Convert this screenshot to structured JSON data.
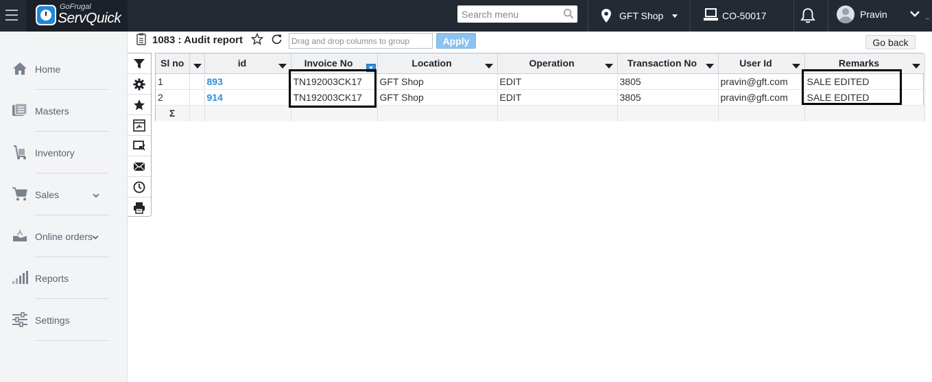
{
  "topbar": {
    "brand_small": "GoFrugal",
    "brand_name": "ServQuick",
    "search_placeholder": "Search menu",
    "location": "GFT Shop",
    "counter": "CO-50017",
    "user": "Pravin",
    "more": "..."
  },
  "sidebar": {
    "items": [
      {
        "label": "Home",
        "icon": "home-icon"
      },
      {
        "label": "Masters",
        "icon": "masters-icon"
      },
      {
        "label": "Inventory",
        "icon": "inventory-icon"
      },
      {
        "label": "Sales",
        "icon": "cart-icon",
        "expandable": true
      },
      {
        "label": "Online orders",
        "icon": "online-orders-icon",
        "expandable": true
      },
      {
        "label": "Reports",
        "icon": "bar-chart-icon"
      },
      {
        "label": "Settings",
        "icon": "sliders-icon"
      }
    ]
  },
  "page": {
    "title": "1083 : Audit report",
    "group_placeholder": "Drag and drop columns to group",
    "apply_label": "Apply",
    "go_back_label": "Go back"
  },
  "tools": [
    "filter-icon",
    "gear-icon",
    "star-icon",
    "column-chooser-icon",
    "export-icon",
    "mail-icon",
    "clock-icon",
    "print-icon"
  ],
  "grid": {
    "columns": [
      "Sl no",
      "id",
      "Invoice No",
      "Location",
      "Operation",
      "Transaction No",
      "User Id",
      "Remarks"
    ],
    "rows": [
      {
        "sl": "1",
        "id": "893",
        "invoice": "TN192003CK17",
        "location": "GFT Shop",
        "operation": "EDIT",
        "txn": "3805",
        "user": "pravin@gft.com",
        "remarks": "SALE EDITED"
      },
      {
        "sl": "2",
        "id": "914",
        "invoice": "TN192003CK17",
        "location": "GFT Shop",
        "operation": "EDIT",
        "txn": "3805",
        "user": "pravin@gft.com",
        "remarks": "SALE EDITED"
      }
    ],
    "footer_symbol": "Σ"
  },
  "colors": {
    "topbar": "#242a33",
    "sidebar": "#f3f4f6",
    "link": "#2e8de1",
    "apply_button": "#8cc2f1"
  }
}
